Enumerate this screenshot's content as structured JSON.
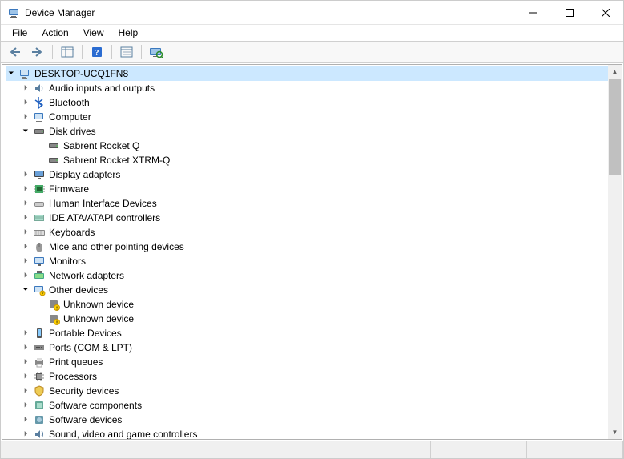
{
  "window": {
    "title": "Device Manager"
  },
  "menu": {
    "file": "File",
    "action": "Action",
    "view": "View",
    "help": "Help"
  },
  "tree": {
    "root": "DESKTOP-UCQ1FN8",
    "nodes": [
      {
        "icon": "audio",
        "label": "Audio inputs and outputs",
        "state": "closed"
      },
      {
        "icon": "bluetooth",
        "label": "Bluetooth",
        "state": "closed"
      },
      {
        "icon": "computer",
        "label": "Computer",
        "state": "closed"
      },
      {
        "icon": "disk",
        "label": "Disk drives",
        "state": "open",
        "children": [
          {
            "icon": "disk",
            "label": "Sabrent Rocket Q"
          },
          {
            "icon": "disk",
            "label": "Sabrent Rocket XTRM-Q"
          }
        ]
      },
      {
        "icon": "display",
        "label": "Display adapters",
        "state": "closed"
      },
      {
        "icon": "firmware",
        "label": "Firmware",
        "state": "closed"
      },
      {
        "icon": "hid",
        "label": "Human Interface Devices",
        "state": "closed"
      },
      {
        "icon": "ide",
        "label": "IDE ATA/ATAPI controllers",
        "state": "closed"
      },
      {
        "icon": "keyboard",
        "label": "Keyboards",
        "state": "closed"
      },
      {
        "icon": "mouse",
        "label": "Mice and other pointing devices",
        "state": "closed"
      },
      {
        "icon": "monitor",
        "label": "Monitors",
        "state": "closed"
      },
      {
        "icon": "network",
        "label": "Network adapters",
        "state": "closed"
      },
      {
        "icon": "other",
        "label": "Other devices",
        "state": "open",
        "children": [
          {
            "icon": "unknown",
            "label": "Unknown device"
          },
          {
            "icon": "unknown",
            "label": "Unknown device"
          }
        ]
      },
      {
        "icon": "portable",
        "label": "Portable Devices",
        "state": "closed"
      },
      {
        "icon": "ports",
        "label": "Ports (COM & LPT)",
        "state": "closed"
      },
      {
        "icon": "printqueue",
        "label": "Print queues",
        "state": "closed"
      },
      {
        "icon": "processor",
        "label": "Processors",
        "state": "closed"
      },
      {
        "icon": "security",
        "label": "Security devices",
        "state": "closed"
      },
      {
        "icon": "swcomp",
        "label": "Software components",
        "state": "closed"
      },
      {
        "icon": "swdev",
        "label": "Software devices",
        "state": "closed"
      },
      {
        "icon": "sound",
        "label": "Sound, video and game controllers",
        "state": "closed"
      }
    ]
  }
}
